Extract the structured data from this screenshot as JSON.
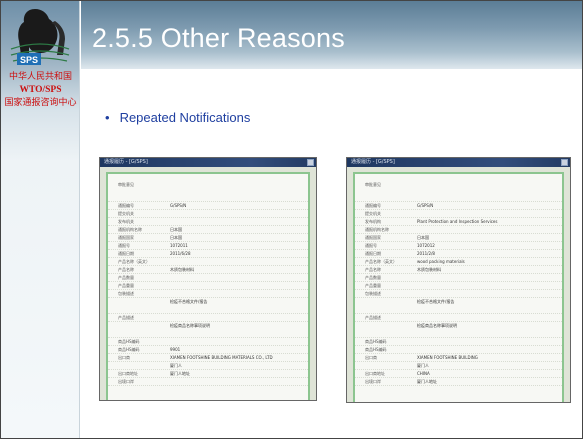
{
  "slide": {
    "title": "2.5.5 Other Reasons",
    "bullet": "Repeated Notifications"
  },
  "logo": {
    "badge_text": "SPS",
    "caption_line1": "中华人民共和国",
    "caption_line2": "WTO/SPS",
    "caption_line3": "国家通报咨询中心"
  },
  "screenshots": [
    {
      "titlebar": "通报履历 - [G/SPS]",
      "heading": "审批意见",
      "rows": [
        {
          "k": "",
          "v": ""
        },
        {
          "k": "通报编号",
          "v": "G/SPS/N"
        },
        {
          "k": "提交机关",
          "v": ""
        },
        {
          "k": "发布机关",
          "v": ""
        },
        {
          "k": "通报机构名称",
          "v": "日本国"
        },
        {
          "k": "通报国家",
          "v": "日本国"
        },
        {
          "k": "通报号",
          "v": "1072011"
        },
        {
          "k": "通报日期",
          "v": "2011/6/28"
        },
        {
          "k": "产品名称（英文）",
          "v": ""
        },
        {
          "k": "产品名称",
          "v": "木质包装材料"
        },
        {
          "k": "产品数量",
          "v": ""
        },
        {
          "k": "产品重量",
          "v": ""
        },
        {
          "k": "包装描述",
          "v": ""
        },
        {
          "k": "",
          "v": "检疫不合格文件/报告"
        },
        {
          "k": "产品描述",
          "v": ""
        },
        {
          "k": "",
          "v": "检疫商品名称事项说明"
        },
        {
          "k": "商品HS编码",
          "v": ""
        },
        {
          "k": "商品HS编码",
          "v": "9901"
        },
        {
          "k": "出口商",
          "v": "XIAMEN FOOTSHINE BUILDING MATERIALS CO., LTD"
        },
        {
          "k": "",
          "v": "厦门人"
        },
        {
          "k": "出口商地址",
          "v": "厦门人地址"
        },
        {
          "k": "出境口岸",
          "v": ""
        }
      ]
    },
    {
      "titlebar": "通报履历 - [G/SPS]",
      "heading": "审批意见",
      "rows": [
        {
          "k": "",
          "v": ""
        },
        {
          "k": "通报编号",
          "v": "G/SPS/N"
        },
        {
          "k": "提交机关",
          "v": ""
        },
        {
          "k": "发布机构",
          "v": "Plant Protection and Inspection Services"
        },
        {
          "k": "通报机构名称",
          "v": ""
        },
        {
          "k": "通报国家",
          "v": "日本国"
        },
        {
          "k": "通报号",
          "v": "1072012"
        },
        {
          "k": "通报日期",
          "v": "2011/2/8"
        },
        {
          "k": "产品名称（英文）",
          "v": "wood packing materials"
        },
        {
          "k": "产品名称",
          "v": "木质包装材料"
        },
        {
          "k": "产品数量",
          "v": ""
        },
        {
          "k": "产品重量",
          "v": ""
        },
        {
          "k": "包装描述",
          "v": ""
        },
        {
          "k": "",
          "v": "检疫不合格文件/报告"
        },
        {
          "k": "产品描述",
          "v": ""
        },
        {
          "k": "",
          "v": "检疫商品名称事项说明"
        },
        {
          "k": "商品HS编码",
          "v": ""
        },
        {
          "k": "商品HS编码",
          "v": ""
        },
        {
          "k": "出口商",
          "v": "XIAMEN FOOTSHINE BUILDING"
        },
        {
          "k": "",
          "v": "厦门人"
        },
        {
          "k": "出口商地址",
          "v": "CHINA"
        },
        {
          "k": "出境口岸",
          "v": "厦门人地址"
        }
      ]
    }
  ]
}
